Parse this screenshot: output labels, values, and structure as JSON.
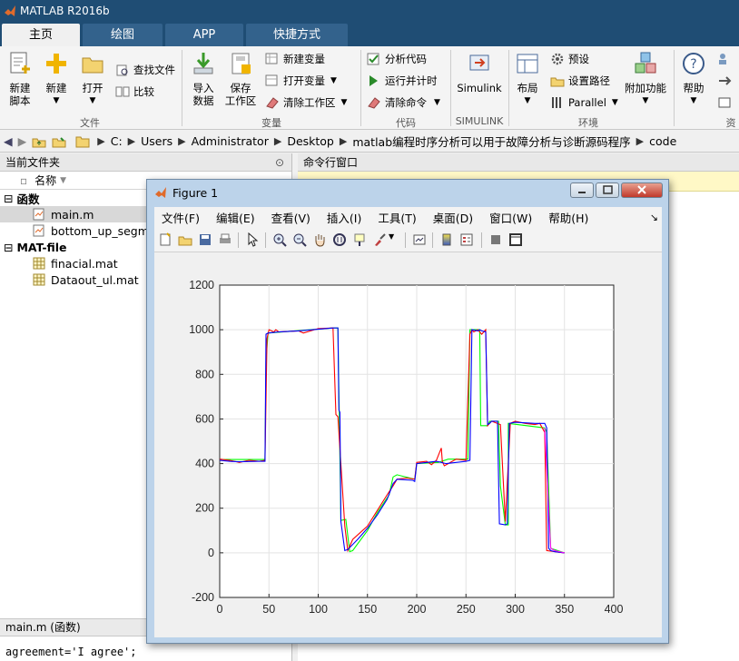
{
  "app": {
    "title": "MATLAB R2016b"
  },
  "tabs": [
    {
      "label": "主页"
    },
    {
      "label": "绘图"
    },
    {
      "label": "APP"
    },
    {
      "label": "快捷方式"
    }
  ],
  "ribbon": {
    "file": {
      "new_script_line1": "新建",
      "new_script_line2": "脚本",
      "new": "新建",
      "open": "打开",
      "find_files": "查找文件",
      "compare": "比较",
      "group": "文件"
    },
    "variable": {
      "import_line1": "导入",
      "import_line2": "数据",
      "save_line1": "保存",
      "save_line2": "工作区",
      "new_var": "新建变量",
      "open_var": "打开变量",
      "clear_ws": "清除工作区",
      "group": "变量"
    },
    "code": {
      "analyze": "分析代码",
      "run_time": "运行并计时",
      "clear_cmd": "清除命令",
      "group": "代码"
    },
    "simulink": {
      "label": "Simulink",
      "group": "SIMULINK"
    },
    "environment": {
      "layout": "布局",
      "prefs": "预设",
      "set_path": "设置路径",
      "parallel": "Parallel",
      "addons": "附加功能",
      "group": "环境"
    },
    "help": {
      "label": "帮助"
    },
    "cut_group": "资"
  },
  "address": {
    "crumbs": [
      "C:",
      "Users",
      "Administrator",
      "Desktop",
      "matlab编程时序分析可以用于故障分析与诊断源码程序",
      "code"
    ]
  },
  "current_folder": {
    "title": "当前文件夹",
    "col_name": "名称",
    "groups": [
      {
        "label": "函数",
        "items": [
          "main.m",
          "bottom_up_segme"
        ]
      },
      {
        "label": "MAT-file",
        "items": [
          "finacial.mat",
          "Dataout_ul.mat"
        ]
      }
    ],
    "details": "main.m  (函数)",
    "code_line": "agreement='I agree';"
  },
  "command_window": {
    "title": "命令行窗口"
  },
  "figure": {
    "title": "Figure 1",
    "menu": [
      "文件(F)",
      "编辑(E)",
      "查看(V)",
      "插入(I)",
      "工具(T)",
      "桌面(D)",
      "窗口(W)",
      "帮助(H)"
    ]
  },
  "chart_data": {
    "type": "line",
    "xlim": [
      0,
      400
    ],
    "ylim": [
      -200,
      1200
    ],
    "xticks": [
      0,
      50,
      100,
      150,
      200,
      250,
      300,
      350,
      400
    ],
    "yticks": [
      -200,
      0,
      200,
      400,
      600,
      800,
      1000,
      1200
    ],
    "grid": true,
    "series": [
      {
        "color": "#00ff00",
        "x": [
          0,
          46,
          47,
          49,
          115,
          120,
          123,
          128,
          132,
          135,
          140,
          150,
          160,
          172,
          176,
          180,
          198,
          200,
          222,
          232,
          252,
          254,
          256,
          258,
          264,
          265,
          272,
          274,
          283,
          285,
          290,
          293,
          293,
          330,
          332,
          336,
          350
        ],
        "y": [
          418,
          418,
          860,
          985,
          1008,
          1008,
          145,
          150,
          5,
          10,
          40,
          100,
          180,
          260,
          340,
          350,
          330,
          400,
          405,
          420,
          420,
          1000,
          1000,
          1000,
          1000,
          570,
          570,
          590,
          590,
          300,
          125,
          125,
          580,
          560,
          540,
          20,
          0
        ]
      },
      {
        "color": "#ff0000",
        "x": [
          0,
          10,
          20,
          30,
          40,
          46,
          48,
          50,
          55,
          57,
          60,
          80,
          85,
          100,
          115,
          118,
          120,
          127,
          130,
          135,
          140,
          150,
          160,
          170,
          176,
          180,
          190,
          198,
          200,
          210,
          215,
          220,
          225,
          226,
          228,
          232,
          240,
          250,
          254,
          256,
          258,
          262,
          266,
          270,
          272,
          274,
          276,
          285,
          290,
          295,
          300,
          310,
          320,
          325,
          330,
          332,
          340,
          350
        ],
        "y": [
          420,
          415,
          405,
          415,
          410,
          415,
          960,
          1000,
          990,
          1000,
          990,
          995,
          985,
          1005,
          1008,
          620,
          610,
          120,
          10,
          60,
          80,
          120,
          190,
          260,
          300,
          330,
          335,
          330,
          405,
          410,
          395,
          415,
          470,
          410,
          390,
          400,
          420,
          415,
          980,
          1000,
          990,
          1000,
          980,
          1000,
          570,
          580,
          590,
          575,
          140,
          580,
          590,
          580,
          575,
          580,
          540,
          10,
          5,
          0
        ]
      },
      {
        "color": "#0000ff",
        "x": [
          0,
          10,
          20,
          40,
          46,
          47,
          49,
          60,
          80,
          115,
          120,
          121,
          122,
          123,
          127,
          130,
          140,
          150,
          160,
          170,
          176,
          180,
          196,
          198,
          200,
          210,
          220,
          230,
          250,
          254,
          256,
          262,
          264,
          266,
          270,
          272,
          274,
          276,
          282,
          284,
          290,
          292,
          294,
          300,
          320,
          330,
          332,
          334,
          336,
          340,
          350
        ],
        "y": [
          415,
          410,
          408,
          410,
          410,
          980,
          985,
          990,
          995,
          1008,
          1008,
          640,
          630,
          140,
          10,
          15,
          60,
          110,
          170,
          240,
          310,
          330,
          325,
          320,
          400,
          405,
          410,
          400,
          410,
          415,
          1000,
          995,
          1000,
          995,
          990,
          575,
          580,
          590,
          590,
          130,
          125,
          130,
          580,
          585,
          580,
          580,
          560,
          20,
          10,
          5,
          0
        ]
      },
      {
        "color": "#ff00ff",
        "x": [
          330,
          336,
          340,
          345,
          350
        ],
        "y": [
          560,
          20,
          10,
          5,
          0
        ]
      }
    ]
  }
}
